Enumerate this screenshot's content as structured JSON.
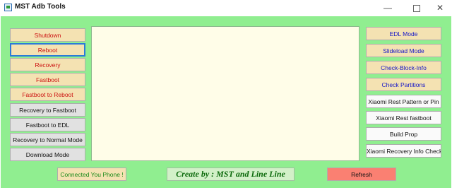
{
  "window": {
    "title": "MST Adb Tools",
    "controls": {
      "minimize": "—",
      "close": "✕"
    }
  },
  "left_buttons": [
    {
      "label": "Shutdown"
    },
    {
      "label": "Reboot"
    },
    {
      "label": "Recovery"
    },
    {
      "label": "Fastboot"
    },
    {
      "label": "Fastboot to Reboot"
    },
    {
      "label": "Recovery to Fastboot"
    },
    {
      "label": "Fastboot to EDL"
    },
    {
      "label": "Recovery to Normal Mode"
    },
    {
      "label": "Download Mode"
    }
  ],
  "right_buttons": [
    {
      "label": "EDL Mode"
    },
    {
      "label": "Slideload Mode"
    },
    {
      "label": "Check-Block-Info"
    },
    {
      "label": "Check Partitions"
    },
    {
      "label": "Xiaomi Rest Pattern or Pin"
    },
    {
      "label": "Xiaomi Rest fastboot"
    },
    {
      "label": "Build Prop"
    },
    {
      "label": "Xiaomi Recovery Info Check"
    }
  ],
  "footer": {
    "status": "Connected You Phone !",
    "credit": "Create by : MST and Line Line",
    "refresh": "Refresh"
  },
  "colors": {
    "client_background": "#90ee90",
    "button_peach": "#f4e2b2",
    "button_gray": "#e1e1e1",
    "refresh_salmon": "#fa8072",
    "log_background": "#fffde8"
  }
}
